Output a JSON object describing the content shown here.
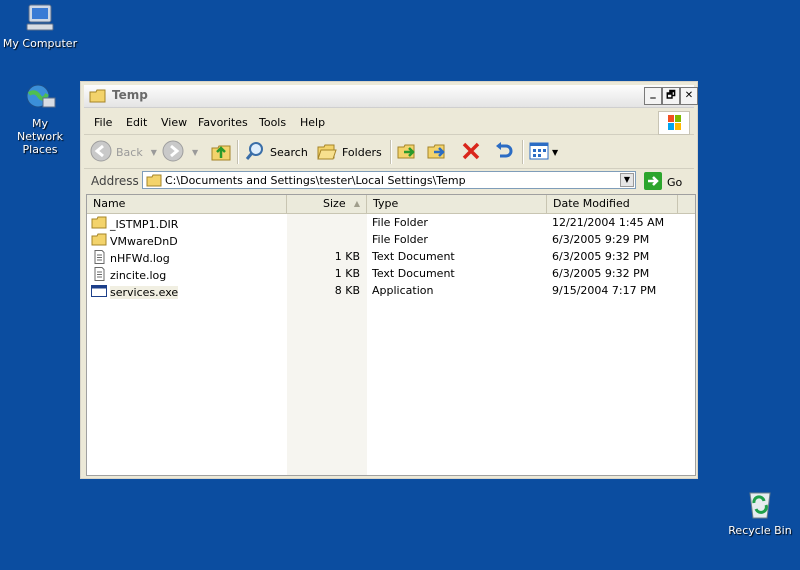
{
  "desktop": {
    "icons": [
      {
        "label": "My Computer",
        "icon": "my-computer-icon"
      },
      {
        "label": "My Network Places",
        "icon": "network-places-icon"
      },
      {
        "label": "Recycle Bin",
        "icon": "recycle-bin-icon"
      }
    ]
  },
  "window": {
    "title": "Temp",
    "buttons": {
      "minimize": "_",
      "restore": "🗗",
      "close": "✕"
    },
    "menu": [
      "File",
      "Edit",
      "View",
      "Favorites",
      "Tools",
      "Help"
    ],
    "toolbar": {
      "back": "Back",
      "search": "Search",
      "folders": "Folders"
    },
    "address": {
      "label": "Address",
      "value": "C:\\Documents and Settings\\tester\\Local Settings\\Temp",
      "go": "Go"
    },
    "columns": {
      "name": "Name",
      "size": "Size",
      "type": "Type",
      "date": "Date Modified"
    },
    "files": [
      {
        "name": "_ISTMP1.DIR",
        "size": "",
        "type": "File Folder",
        "date": "12/21/2004 1:45 AM",
        "icon": "folder-icon"
      },
      {
        "name": "VMwareDnD",
        "size": "",
        "type": "File Folder",
        "date": "6/3/2005 9:29 PM",
        "icon": "folder-icon"
      },
      {
        "name": "nHFWd.log",
        "size": "1 KB",
        "type": "Text Document",
        "date": "6/3/2005 9:32 PM",
        "icon": "text-document-icon"
      },
      {
        "name": "zincite.log",
        "size": "1 KB",
        "type": "Text Document",
        "date": "6/3/2005 9:32 PM",
        "icon": "text-document-icon"
      },
      {
        "name": "services.exe",
        "size": "8 KB",
        "type": "Application",
        "date": "9/15/2004 7:17 PM",
        "icon": "application-icon"
      }
    ]
  }
}
